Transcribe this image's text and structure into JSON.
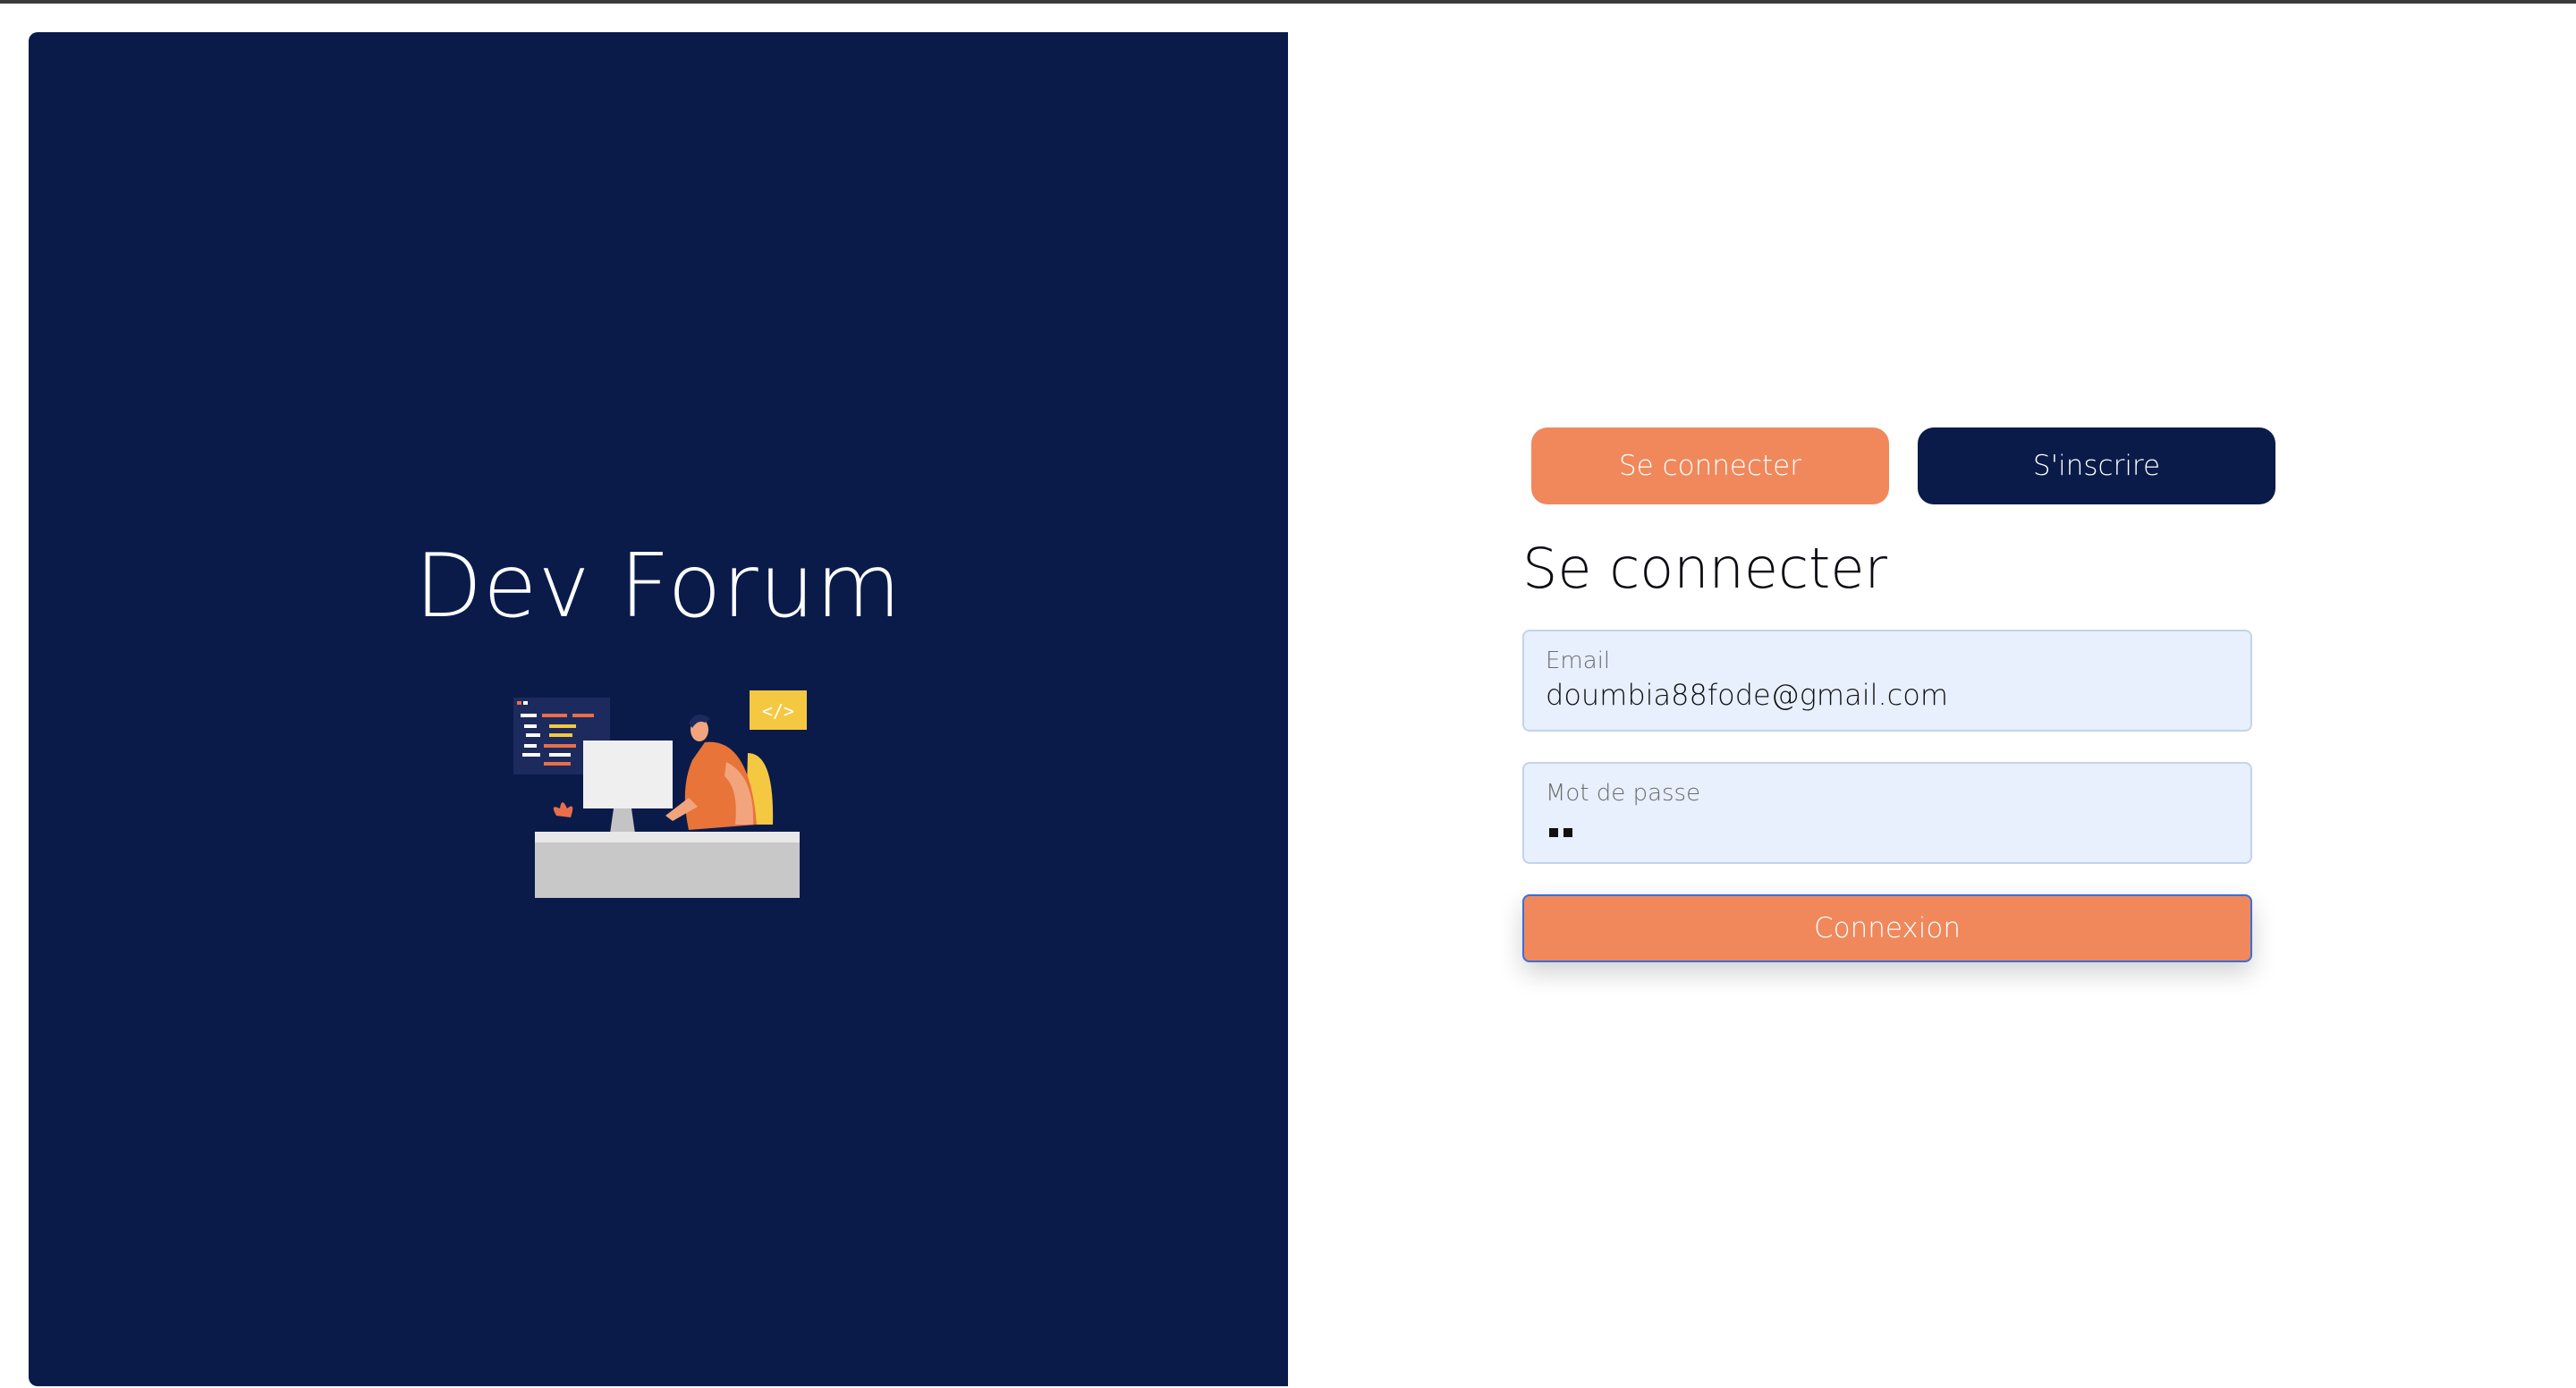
{
  "brand": {
    "title": "Dev Forum",
    "illustration_icon": "developer-at-desk-illustration",
    "illustration_code_badge": "</>"
  },
  "auth_tabs": {
    "login_label": "Se connecter",
    "signup_label": "S'inscrire"
  },
  "form": {
    "title": "Se connecter",
    "email": {
      "label": "Email",
      "value": "doumbia88fode@gmail.com"
    },
    "password": {
      "label": "Mot de passe",
      "masked_chars": 2
    },
    "submit_label": "Connexion"
  },
  "colors": {
    "navy": "#0a1b4a",
    "accent_orange": "#f0885c",
    "field_bg": "#e8effd"
  }
}
